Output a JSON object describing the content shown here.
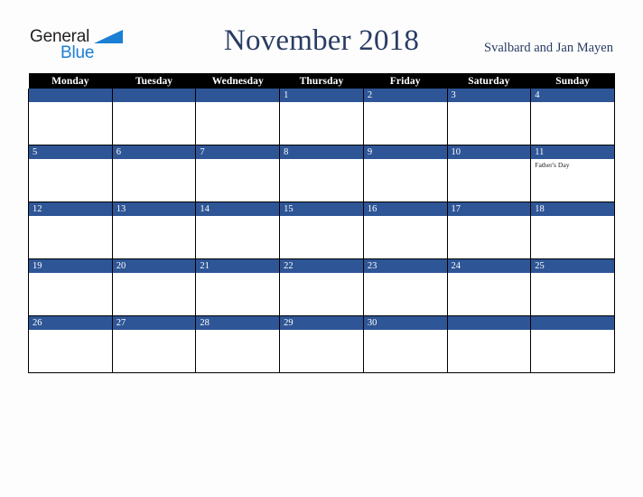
{
  "brand": {
    "name_part1": "General",
    "name_part2": "Blue",
    "triangle_color": "#1b7fd4",
    "text_color": "#231f20"
  },
  "header": {
    "title": "November 2018",
    "region": "Svalbard and Jan Mayen",
    "title_color": "#2a3c64"
  },
  "theme": {
    "header_row_bg": "#000000",
    "header_row_text": "#ffffff",
    "day_bar_bg": "#2e5596",
    "day_bar_text": "#ffffff",
    "cell_bg": "#ffffff",
    "grid_line": "#000000",
    "page_bg": "#fdfdfd",
    "event_text": "#1a1a1a"
  },
  "calendar": {
    "month": "November",
    "year": "2018",
    "weekday_headers": [
      "Monday",
      "Tuesday",
      "Wednesday",
      "Thursday",
      "Friday",
      "Saturday",
      "Sunday"
    ],
    "weeks": [
      [
        {
          "day": "",
          "events": []
        },
        {
          "day": "",
          "events": []
        },
        {
          "day": "",
          "events": []
        },
        {
          "day": "1",
          "events": []
        },
        {
          "day": "2",
          "events": []
        },
        {
          "day": "3",
          "events": []
        },
        {
          "day": "4",
          "events": []
        }
      ],
      [
        {
          "day": "5",
          "events": []
        },
        {
          "day": "6",
          "events": []
        },
        {
          "day": "7",
          "events": []
        },
        {
          "day": "8",
          "events": []
        },
        {
          "day": "9",
          "events": []
        },
        {
          "day": "10",
          "events": []
        },
        {
          "day": "11",
          "events": [
            "Father's Day"
          ]
        }
      ],
      [
        {
          "day": "12",
          "events": []
        },
        {
          "day": "13",
          "events": []
        },
        {
          "day": "14",
          "events": []
        },
        {
          "day": "15",
          "events": []
        },
        {
          "day": "16",
          "events": []
        },
        {
          "day": "17",
          "events": []
        },
        {
          "day": "18",
          "events": []
        }
      ],
      [
        {
          "day": "19",
          "events": []
        },
        {
          "day": "20",
          "events": []
        },
        {
          "day": "21",
          "events": []
        },
        {
          "day": "22",
          "events": []
        },
        {
          "day": "23",
          "events": []
        },
        {
          "day": "24",
          "events": []
        },
        {
          "day": "25",
          "events": []
        }
      ],
      [
        {
          "day": "26",
          "events": []
        },
        {
          "day": "27",
          "events": []
        },
        {
          "day": "28",
          "events": []
        },
        {
          "day": "29",
          "events": []
        },
        {
          "day": "30",
          "events": []
        },
        {
          "day": "",
          "events": []
        },
        {
          "day": "",
          "events": []
        }
      ]
    ]
  }
}
